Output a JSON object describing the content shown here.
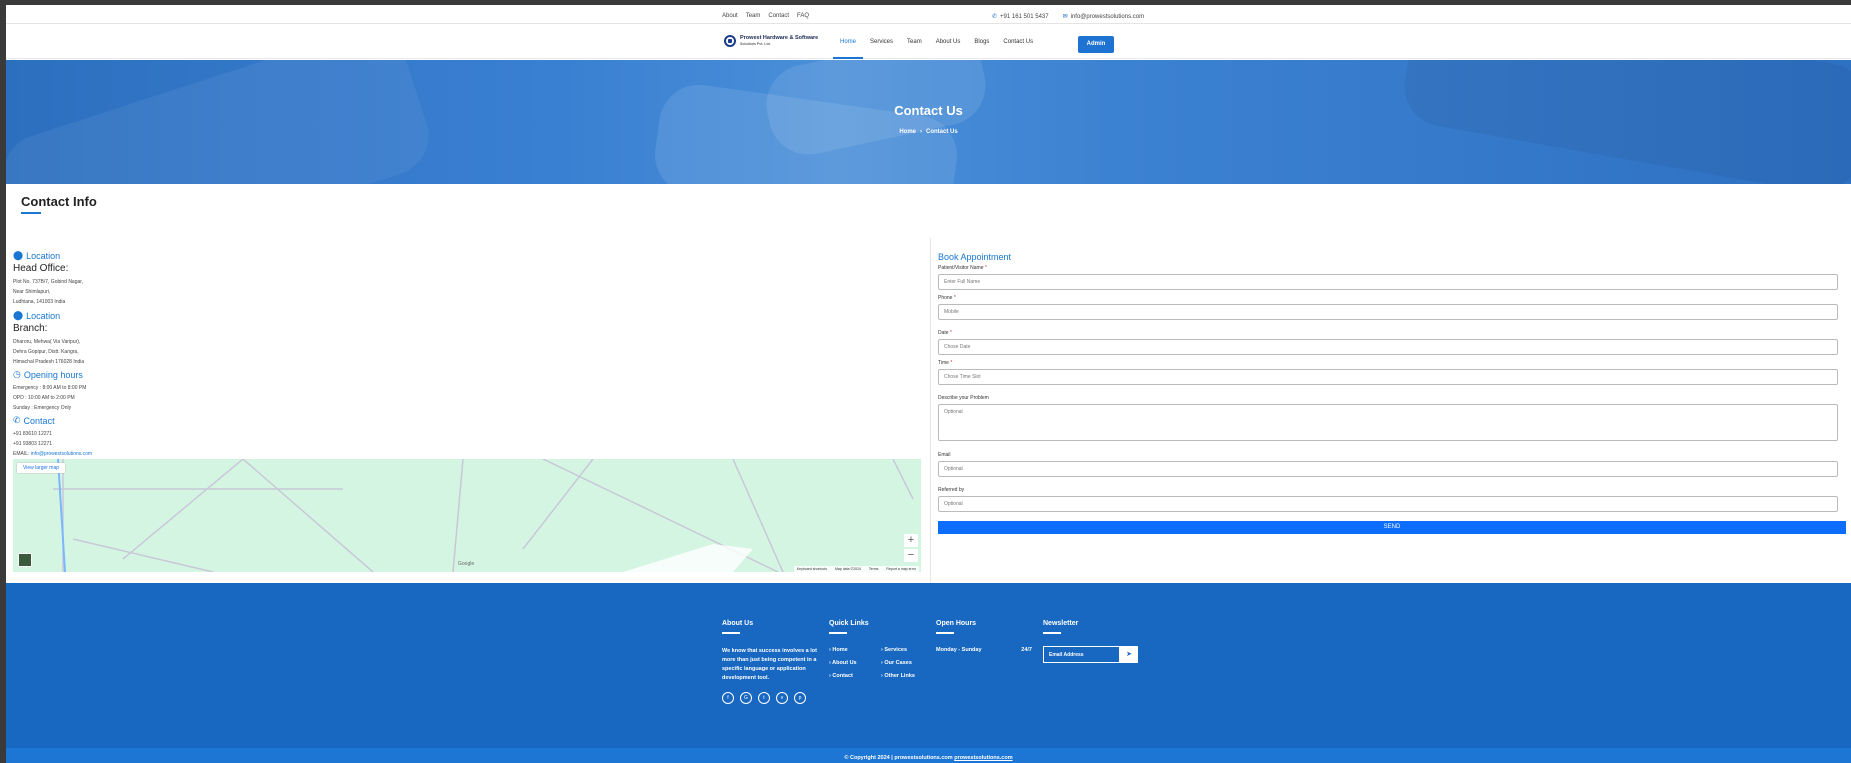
{
  "topbar": {
    "links": [
      "About",
      "Team",
      "Contact",
      "FAQ"
    ],
    "phone": "+91 161 501 5437",
    "email": "info@prowestsolutions.com",
    "phone_icon": "phone-icon",
    "email_icon": "envelope-icon"
  },
  "navbar": {
    "brand_name": "Prowest Hardware & Software",
    "brand_sub": "Solutions Pvt. Ltd.",
    "links": [
      "Home",
      "Services",
      "Team",
      "About Us",
      "Blogs",
      "Contact Us"
    ],
    "active": "Home",
    "admin_label": "Admin"
  },
  "hero": {
    "title": "Contact Us",
    "crumb_home": "Home",
    "crumb_sep": "›",
    "crumb_current": "Contact Us"
  },
  "contact_info": {
    "title": "Contact Info",
    "location1_label": "Location",
    "head_office": "Head Office:",
    "head_addr1": "Plot No. 737B/7, Gobind Nagar,",
    "head_addr2": "Near Shimlapuri,",
    "head_addr3": "Ludhiana, 141003 India",
    "location2_label": "Location",
    "branch": "Branch:",
    "branch_addr1": "Dharoru, Mehwa( Via Varipur),",
    "branch_addr2": "Dehra Gopipur, Distt. Kangra,",
    "branch_addr3": "Himachal Pradesh 176028 India",
    "hours_label": "Opening hours",
    "hours1": "Emergency : 8:00 AM to 8:00 PM",
    "hours2": "OPD : 10:00 AM to 2:00 PM",
    "hours3": "Sunday : Emergency Only",
    "contact_label": "Contact",
    "phone1": "+91 83610 12271",
    "phone2": "+91 93803 12271",
    "email_prefix": "EMAIL:",
    "email": "info@prowestsolutions.com"
  },
  "map": {
    "larger_map": "View larger map",
    "zoom_in": "+",
    "zoom_out": "−",
    "google": "Google",
    "footer_items": [
      "Keyboard shortcuts",
      "Map data ©2024",
      "Terms",
      "Report a map error"
    ]
  },
  "booking": {
    "title": "Book Appointment",
    "name_label": "Patient/Visitor Name",
    "name_placeholder": "Enter Full Name",
    "phone_label": "Phone",
    "phone_placeholder": "Mobile",
    "date_label": "Date",
    "date_placeholder": "Chose Date",
    "time_label": "Time",
    "time_placeholder": "Chose Time Slot",
    "problem_label": "Describe your Problem",
    "problem_placeholder": "Optional",
    "email_label": "Email",
    "email_placeholder": "Optional",
    "referred_label": "Referred by",
    "referred_placeholder": "Optional",
    "required_mark": "*",
    "send_label": "SEND"
  },
  "footer": {
    "about_title": "About Us",
    "about_text": "We know that success involves a lot more than just being competent in a specific language or application development tool.",
    "social_icons": [
      "facebook-icon",
      "google-plus-icon",
      "twitter-icon",
      "vimeo-icon",
      "pinterest-icon"
    ],
    "quick_title": "Quick Links",
    "quick_links": [
      "Home",
      "Services",
      "About Us",
      "Our Cases",
      "Contact",
      "Other Links"
    ],
    "hours_title": "Open Hours",
    "hours_day": "Monday - Sunday",
    "hours_value": "24/7",
    "news_title": "Newsletter",
    "news_placeholder": "Email Address",
    "copyright": "© Copyright 2024 | prowestsolutions.com",
    "copyright_link": "prowestsolutions.com"
  },
  "colors": {
    "accent": "#1976d2",
    "hero": "#3a80d2",
    "footer": "#1868c2",
    "send": "#0d6efd"
  }
}
